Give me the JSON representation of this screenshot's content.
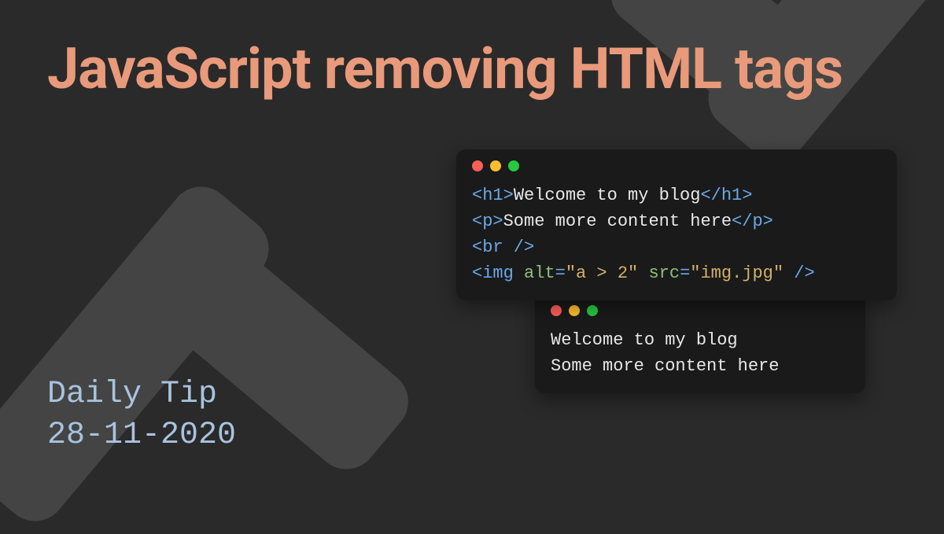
{
  "title": "JavaScript removing HTML tags",
  "meta": {
    "label": "Daily Tip",
    "date": "28-11-2020"
  },
  "code": {
    "l1_open": "<h1>",
    "l1_text": "Welcome to my blog",
    "l1_close": "</h1>",
    "l2_open": "<p>",
    "l2_text": "Some more content here",
    "l2_close": "</p>",
    "l3_open": "<br",
    "l3_close": " />",
    "l4_open": "<img",
    "l4_attr1": " alt",
    "l4_eq1": "=",
    "l4_val1": "\"a > 2\"",
    "l4_attr2": " src",
    "l4_eq2": "=",
    "l4_val2": "\"img.jpg\"",
    "l4_close": " />"
  },
  "output": {
    "l1": "Welcome to my blog",
    "l2": "Some more content here"
  }
}
